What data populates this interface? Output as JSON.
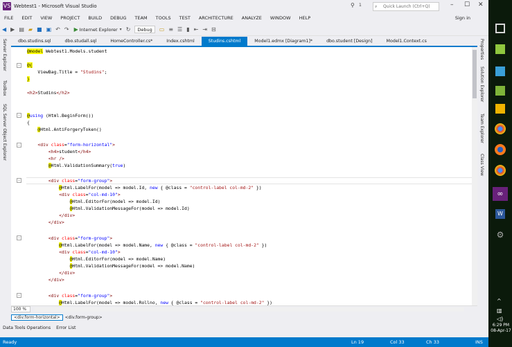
{
  "window": {
    "title": "Webtest1 - Microsoft Visual Studio",
    "logo": "VS",
    "quick_launch_placeholder": "Quick Launch (Ctrl+Q)",
    "notification_count": "1",
    "sign_in": "Sign in"
  },
  "menu": [
    "FILE",
    "EDIT",
    "VIEW",
    "PROJECT",
    "BUILD",
    "DEBUG",
    "TEAM",
    "TOOLS",
    "TEST",
    "ARCHITECTURE",
    "ANALYZE",
    "WINDOW",
    "HELP"
  ],
  "toolbar": {
    "run_target": "Internet Explorer",
    "configuration": "Debug"
  },
  "left_rail": [
    "Server Explorer",
    "Toolbox",
    "SQL Server Object Explorer"
  ],
  "right_rail": [
    "Properties",
    "Solution Explorer",
    "Team Explorer",
    "Class View"
  ],
  "doc_tabs": [
    {
      "label": "dbo.studins.sql",
      "active": false
    },
    {
      "label": "dbo.studall.sql",
      "active": false
    },
    {
      "label": "HomeController.cs*",
      "active": false
    },
    {
      "label": "Index.cshtml",
      "active": false
    },
    {
      "label": "Studins.cshtml",
      "active": true
    },
    {
      "label": "Model1.edmx [Diagram1]*",
      "active": false
    },
    {
      "label": "dbo.student [Design]",
      "active": false
    },
    {
      "label": "Model1.Context.cs",
      "active": false
    }
  ],
  "editor": {
    "zoom": "100 %",
    "breadcrumb": [
      "<div.form-horizontal>",
      "<div.form-group>"
    ]
  },
  "bottom_tabs": [
    "Data Tools Operations",
    "Error List"
  ],
  "status": {
    "state": "Ready",
    "line": "Ln 19",
    "col": "Col 33",
    "ch": "Ch 33",
    "mode": "INS"
  },
  "taskbar": {
    "time": "6:29 PM",
    "date": "08-Apr-17"
  },
  "colors": {
    "accent": "#007acc",
    "vs_purple": "#68217a",
    "keyword": "#0000ff",
    "html_tag": "#800000",
    "attribute": "#ff0000",
    "razor_highlight": "#ffff00"
  }
}
